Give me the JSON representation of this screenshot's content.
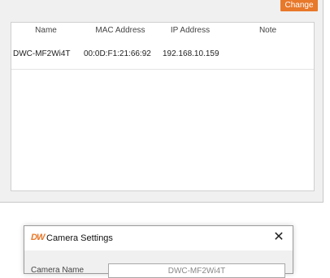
{
  "panel": {
    "change_button": "Change",
    "columns": {
      "name": "Name",
      "mac": "MAC Address",
      "ip": "IP Address",
      "note": "Note"
    },
    "rows": [
      {
        "name": "DWC-MF2Wi4T",
        "mac": "00:0D:F1:21:66:92",
        "ip": "192.168.10.159",
        "note": ""
      }
    ]
  },
  "dialog": {
    "logo": "DW",
    "title": "Camera Settings",
    "close_glyph": "✕",
    "field_label": "Camera Name",
    "field_value": "DWC-MF2Wi4T"
  },
  "colors": {
    "accent": "#e8782a",
    "panel_bg": "#f0f0f0"
  }
}
